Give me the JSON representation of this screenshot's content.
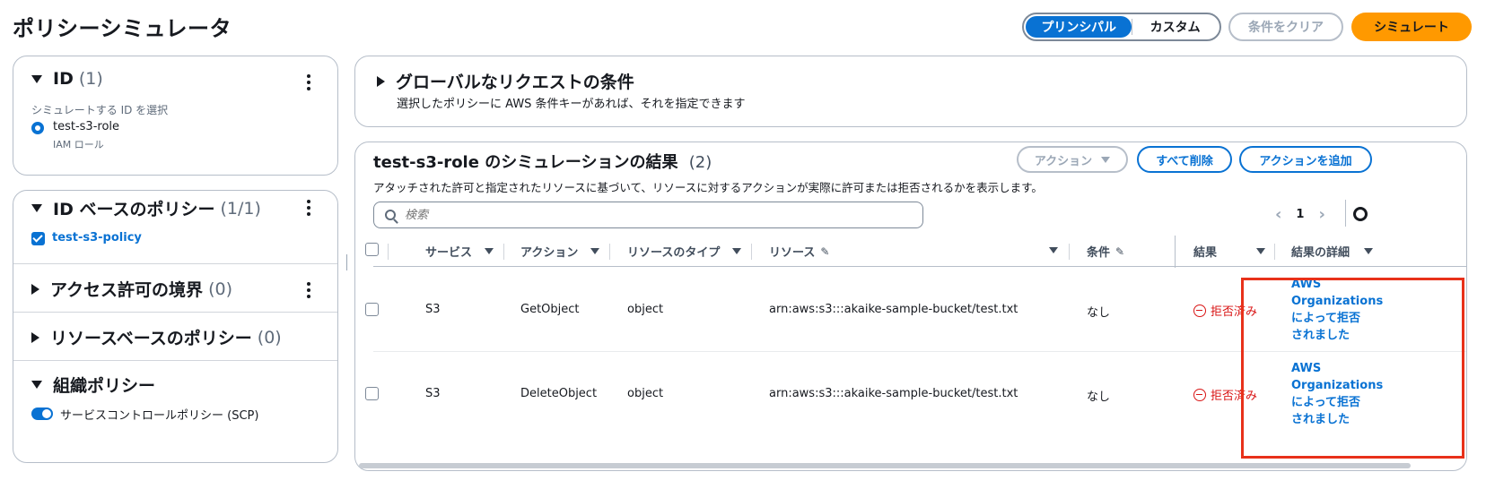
{
  "page_title": "ポリシーシミュレータ",
  "header": {
    "segment": [
      "プリンシパル",
      "カスタム"
    ],
    "clear_label": "条件をクリア",
    "simulate_label": "シミュレート"
  },
  "identity": {
    "title": "ID",
    "count": "(1)",
    "select_label": "シミュレートする ID を選択",
    "selected_role": "test-s3-role",
    "role_type": "IAM ロール"
  },
  "identity_policies": {
    "title": "ID ベースのポリシー",
    "count": "(1/1)",
    "policy": "test-s3-policy"
  },
  "permissions_boundary": {
    "title": "アクセス許可の境界",
    "count": "(0)"
  },
  "resource_policies": {
    "title": "リソースベースのポリシー",
    "count": "(0)"
  },
  "org_policies": {
    "title": "組織ポリシー",
    "scp_label": "サービスコントロールポリシー (SCP)"
  },
  "global_conditions": {
    "title": "グローバルなリクエストの条件",
    "description": "選択したポリシーに AWS 条件キーがあれば、それを指定できます"
  },
  "results": {
    "title": "test-s3-role のシミュレーションの結果",
    "count": "(2)",
    "description": "アタッチされた許可と指定されたリソースに基づいて、リソースに対するアクションが実際に許可または拒否されるかを表示します。",
    "actions_label": "アクション",
    "delete_all_label": "すべて削除",
    "add_action_label": "アクションを追加",
    "search_placeholder": "検索",
    "page": "1",
    "columns": {
      "service": "サービス",
      "action": "アクション",
      "resource_type": "リソースのタイプ",
      "resource": "リソース",
      "condition": "条件",
      "result": "結果",
      "result_detail": "結果の詳細"
    },
    "rows": [
      {
        "service": "S3",
        "action": "GetObject",
        "resource_type": "object",
        "resource": "arn:aws:s3:::akaike-sample-bucket/test.txt",
        "condition": "なし",
        "result": "拒否済み",
        "detail": [
          "AWS",
          "Organizations",
          "によって拒否",
          "されました"
        ]
      },
      {
        "service": "S3",
        "action": "DeleteObject",
        "resource_type": "object",
        "resource": "arn:aws:s3:::akaike-sample-bucket/test.txt",
        "condition": "なし",
        "result": "拒否済み",
        "detail": [
          "AWS",
          "Organizations",
          "によって拒否",
          "されました"
        ]
      }
    ]
  },
  "colors": {
    "primary": "#0972d3",
    "accent": "#ff9900",
    "denied": "#d91515",
    "highlight_box": "#e8311a"
  }
}
